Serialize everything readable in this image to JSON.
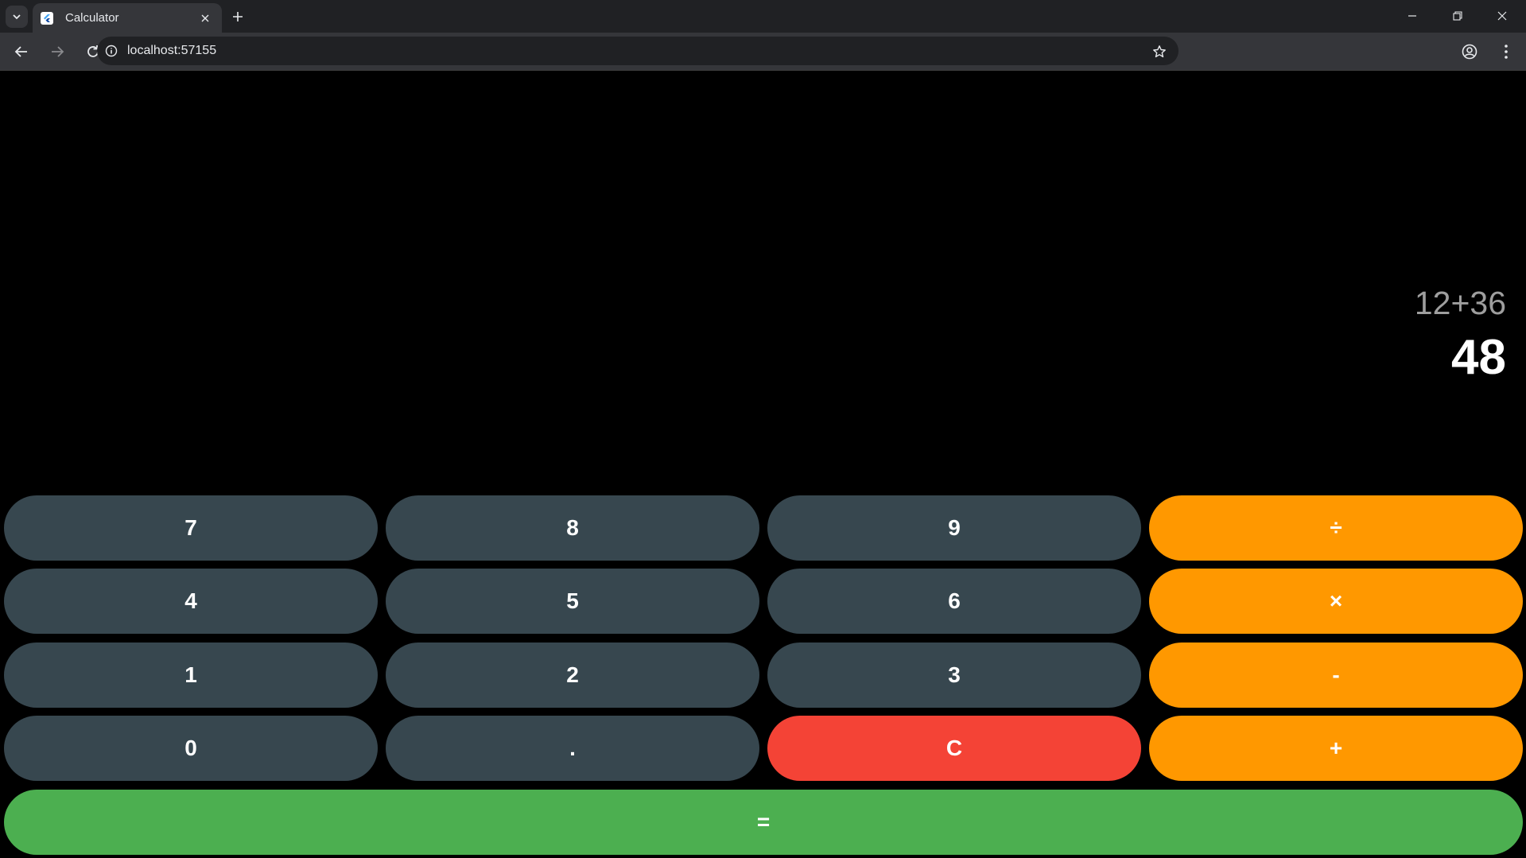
{
  "browser": {
    "tab_title": "Calculator",
    "url": "localhost:57155"
  },
  "calculator": {
    "expression": "12+36",
    "result": "48",
    "keys": {
      "k7": "7",
      "k8": "8",
      "k9": "9",
      "div": "÷",
      "k4": "4",
      "k5": "5",
      "k6": "6",
      "mul": "×",
      "k1": "1",
      "k2": "2",
      "k3": "3",
      "sub": "-",
      "k0": "0",
      "dot": ".",
      "clear": "C",
      "add": "+",
      "eq": "="
    }
  },
  "colors": {
    "number_key": "#37474f",
    "operator_key": "#ff9800",
    "clear_key": "#f44336",
    "equals_key": "#4caf50"
  }
}
